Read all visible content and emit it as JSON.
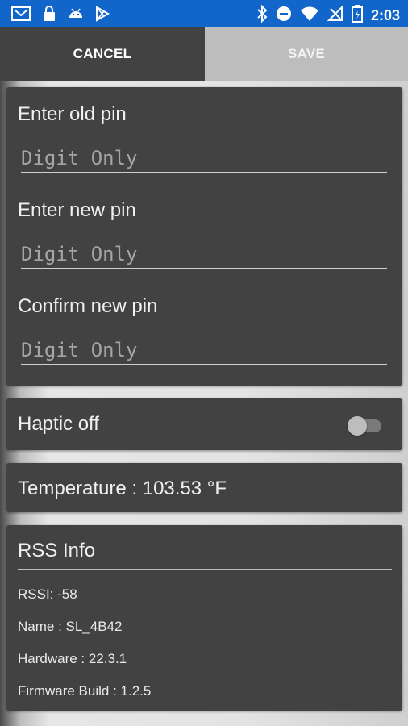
{
  "status_bar": {
    "icons_left": [
      "mail-icon",
      "lock-icon",
      "android-icon",
      "play-store-icon"
    ],
    "icons_right": [
      "bluetooth-icon",
      "do-not-disturb-icon",
      "wifi-icon",
      "signal-icon",
      "battery-icon"
    ],
    "time": "2:03",
    "color": "#1366c9"
  },
  "toolbar": {
    "cancel_label": "CANCEL",
    "save_label": "SAVE"
  },
  "pin_form": {
    "old_pin_label": "Enter old pin",
    "old_pin_placeholder": "Digit Only",
    "old_pin_value": "",
    "new_pin_label": "Enter new pin",
    "new_pin_placeholder": "Digit Only",
    "new_pin_value": "",
    "confirm_pin_label": "Confirm new pin",
    "confirm_pin_placeholder": "Digit Only",
    "confirm_pin_value": ""
  },
  "haptic": {
    "label": "Haptic off",
    "enabled": false
  },
  "temperature": {
    "text": "Temperature : 103.53 °F"
  },
  "rss_info": {
    "title": "RSS Info",
    "rssi": "RSSI: -58",
    "name": "Name : SL_4B42",
    "hardware": "Hardware : 22.3.1",
    "firmware": "Firmware Build : 1.2.5"
  }
}
